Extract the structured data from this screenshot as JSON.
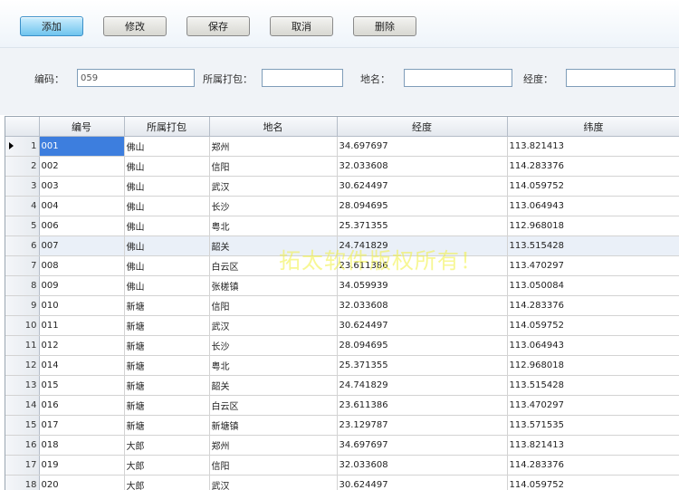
{
  "toolbar": {
    "add_label": "添加",
    "edit_label": "修改",
    "save_label": "保存",
    "cancel_label": "取消",
    "delete_label": "删除"
  },
  "filters": {
    "code_label": "编码：",
    "code_value": "059",
    "package_label": "所属打包：",
    "package_value": "",
    "place_label": "地名：",
    "place_value": "",
    "lng_label": "经度：",
    "lng_value": ""
  },
  "grid": {
    "columns": [
      "编号",
      "所属打包",
      "地名",
      "经度",
      "纬度"
    ],
    "selected_row": 1,
    "highlighted_row": 6,
    "rows": [
      {
        "n": "1",
        "id": "001",
        "pkg": "佛山",
        "place": "郑州",
        "lng": "34.697697",
        "lat": "113.821413"
      },
      {
        "n": "2",
        "id": "002",
        "pkg": "佛山",
        "place": "信阳",
        "lng": "32.033608",
        "lat": "114.283376"
      },
      {
        "n": "3",
        "id": "003",
        "pkg": "佛山",
        "place": "武汉",
        "lng": "30.624497",
        "lat": "114.059752"
      },
      {
        "n": "4",
        "id": "004",
        "pkg": "佛山",
        "place": "长沙",
        "lng": "28.094695",
        "lat": "113.064943"
      },
      {
        "n": "5",
        "id": "006",
        "pkg": "佛山",
        "place": "粤北",
        "lng": "25.371355",
        "lat": "112.968018"
      },
      {
        "n": "6",
        "id": "007",
        "pkg": "佛山",
        "place": "韶关",
        "lng": "24.741829",
        "lat": "113.515428"
      },
      {
        "n": "7",
        "id": "008",
        "pkg": "佛山",
        "place": "白云区",
        "lng": "23.611386",
        "lat": "113.470297"
      },
      {
        "n": "8",
        "id": "009",
        "pkg": "佛山",
        "place": "张槎镇",
        "lng": "34.059939",
        "lat": "113.050084"
      },
      {
        "n": "9",
        "id": "010",
        "pkg": "新塘",
        "place": "信阳",
        "lng": "32.033608",
        "lat": "114.283376"
      },
      {
        "n": "10",
        "id": "011",
        "pkg": "新塘",
        "place": "武汉",
        "lng": "30.624497",
        "lat": "114.059752"
      },
      {
        "n": "11",
        "id": "012",
        "pkg": "新塘",
        "place": "长沙",
        "lng": "28.094695",
        "lat": "113.064943"
      },
      {
        "n": "12",
        "id": "014",
        "pkg": "新塘",
        "place": "粤北",
        "lng": "25.371355",
        "lat": "112.968018"
      },
      {
        "n": "13",
        "id": "015",
        "pkg": "新塘",
        "place": "韶关",
        "lng": "24.741829",
        "lat": "113.515428"
      },
      {
        "n": "14",
        "id": "016",
        "pkg": "新塘",
        "place": "白云区",
        "lng": "23.611386",
        "lat": "113.470297"
      },
      {
        "n": "15",
        "id": "017",
        "pkg": "新塘",
        "place": "新塘镇",
        "lng": "23.129787",
        "lat": "113.571535"
      },
      {
        "n": "16",
        "id": "018",
        "pkg": "大郎",
        "place": "郑州",
        "lng": "34.697697",
        "lat": "113.821413"
      },
      {
        "n": "17",
        "id": "019",
        "pkg": "大郎",
        "place": "信阳",
        "lng": "32.033608",
        "lat": "114.283376"
      },
      {
        "n": "18",
        "id": "020",
        "pkg": "大郎",
        "place": "武汉",
        "lng": "30.624497",
        "lat": "114.059752"
      }
    ]
  },
  "watermark": "拓太软件版权所有！",
  "colors": {
    "primary_button": "#6fc4ee",
    "selected_cell": "#3d7ede",
    "highlight_row": "#eaf0f8",
    "watermark": "#f0f03c"
  }
}
